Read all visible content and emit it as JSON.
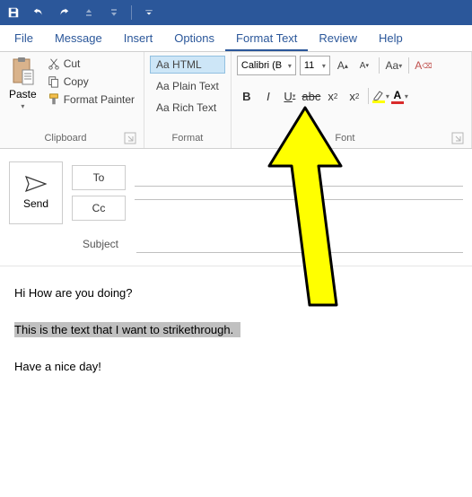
{
  "qat": {
    "save": "save",
    "undo": "undo",
    "redo": "redo",
    "up": "up",
    "down": "down"
  },
  "tabs": {
    "file": "File",
    "message": "Message",
    "insert": "Insert",
    "options": "Options",
    "format_text": "Format Text",
    "review": "Review",
    "help": "Help"
  },
  "clipboard": {
    "paste": "Paste",
    "cut": "Cut",
    "copy": "Copy",
    "format_painter": "Format Painter",
    "label": "Clipboard"
  },
  "format": {
    "html": "Aa HTML",
    "plain": "Aa Plain Text",
    "rich": "Aa Rich Text",
    "label": "Format"
  },
  "font": {
    "name": "Calibri (B",
    "size": "11",
    "grow": "A",
    "shrink": "A",
    "change_case": "Aa",
    "clear": "A",
    "bold": "B",
    "italic": "I",
    "underline": "U",
    "strike": "abc",
    "sub_x": "x",
    "sub_2": "2",
    "sup_x": "x",
    "sup_2": "2",
    "highlight_color": "#ffff00",
    "font_color": "#d92b2b",
    "label": "Font"
  },
  "compose": {
    "send": "Send",
    "to": "To",
    "cc": "Cc",
    "subject": "Subject"
  },
  "body": {
    "line1": "Hi How are you doing?",
    "line2": "This is the text that I want to strikethrough.",
    "line3": "Have a nice day!"
  }
}
